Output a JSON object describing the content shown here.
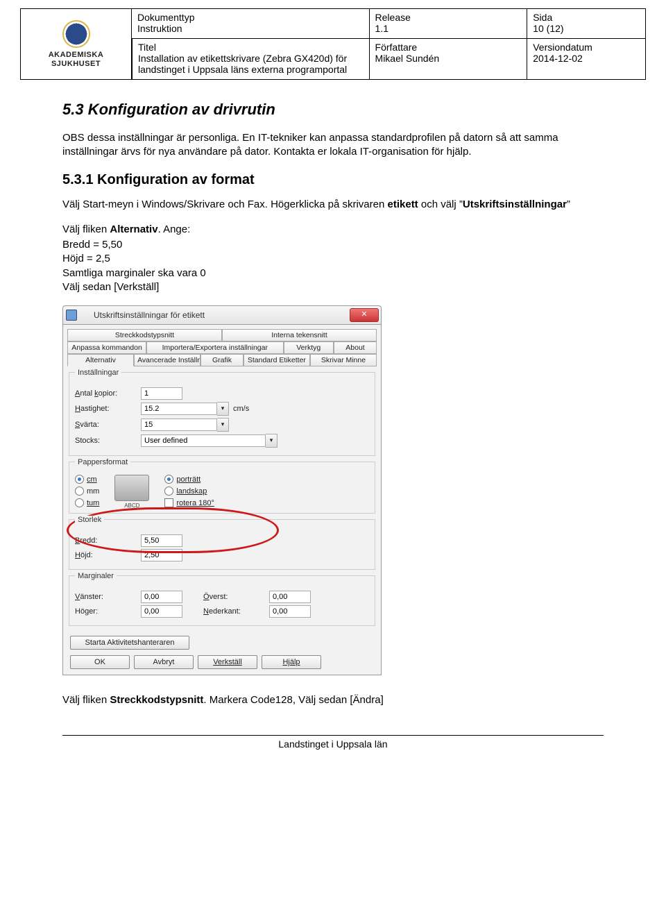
{
  "header": {
    "logo_line1": "AKADEMISKA",
    "logo_line2": "SJUKHUSET",
    "dokumenttyp_label": "Dokumenttyp",
    "dokumenttyp_value": "Instruktion",
    "release_label": "Release",
    "release_value": "1.1",
    "sida_label": "Sida",
    "sida_value": "10 (12)",
    "titel_label": "Titel",
    "titel_value": "Installation av etikettskrivare (Zebra GX420d) för landstinget i Uppsala läns externa programportal",
    "forfattare_label": "Författare",
    "forfattare_value": "Mikael Sundén",
    "versionsdatum_label": "Versiondatum",
    "versionsdatum_value": "2014-12-02"
  },
  "sections": {
    "h53": "5.3  Konfiguration av drivrutin",
    "p1": "OBS dessa inställningar är personliga. En IT-tekniker kan anpassa standardprofilen på datorn så att samma inställningar ärvs för nya användare på dator. Kontakta er lokala IT-organisation för hjälp.",
    "h531": "5.3.1  Konfiguration av format",
    "p2a": "Välj Start-meyn i Windows/Skrivare och Fax. Högerklicka på skrivaren ",
    "p2b": "etikett",
    "p2c": " och välj ”",
    "p2d": "Utskriftsinställningar",
    "p2e": "”",
    "p3a": "Välj fliken ",
    "p3b": "Alternativ",
    "p3c": ". Ange:",
    "p4": "Bredd = 5,50",
    "p5": "Höjd = 2,5",
    "p6": "Samtliga marginaler ska vara 0",
    "p7": "Välj sedan [Verkställ]",
    "p8a": "Välj fliken ",
    "p8b": "Streckkodstypsnitt",
    "p8c": ". Markera Code128,  Välj sedan [Ändra]"
  },
  "dialog": {
    "title": "Utskriftsinställningar för etikett",
    "tabs_top": [
      "Streckkodstypsnitt",
      "Interna tekensnitt"
    ],
    "tabs_mid": [
      "Anpassa kommandon",
      "Importera/Exportera inställningar",
      "Verktyg",
      "About"
    ],
    "tabs_bot": [
      "Alternativ",
      "Avancerade Inställningar",
      "Grafik",
      "Standard Etiketter",
      "Skrivar Minne"
    ],
    "group_install": "Inställningar",
    "antal_label": "Antal kopior:",
    "antal_value": "1",
    "hastighet_label": "Hastighet:",
    "hastighet_value": "15.2",
    "hastighet_unit": "cm/s",
    "svarta_label": "Svärta:",
    "svarta_value": "15",
    "stocks_label": "Stocks:",
    "stocks_value": "User defined",
    "group_papper": "Pappersformat",
    "radio_cm": "cm",
    "radio_mm": "mm",
    "radio_tum": "tum",
    "radio_portratt": "porträtt",
    "radio_landskap": "landskap",
    "check_rotera": "rotera 180°",
    "group_storlek": "Storlek",
    "bredd_label": "Bredd:",
    "bredd_value": "5,50",
    "hojd_label": "Höjd:",
    "hojd_value": "2,50",
    "group_marginaler": "Marginaler",
    "vanster_label": "Vänster:",
    "vanster_value": "0,00",
    "overst_label": "Överst:",
    "overst_value": "0,00",
    "hoger_label": "Höger:",
    "hoger_value": "0,00",
    "nederkant_label": "Nederkant:",
    "nederkant_value": "0,00",
    "btn_starta": "Starta Aktivitetshanteraren",
    "btn_ok": "OK",
    "btn_avbryt": "Avbryt",
    "btn_verkstall": "Verkställ",
    "btn_hjalp": "Hjälp"
  },
  "footer": "Landstinget i Uppsala län"
}
